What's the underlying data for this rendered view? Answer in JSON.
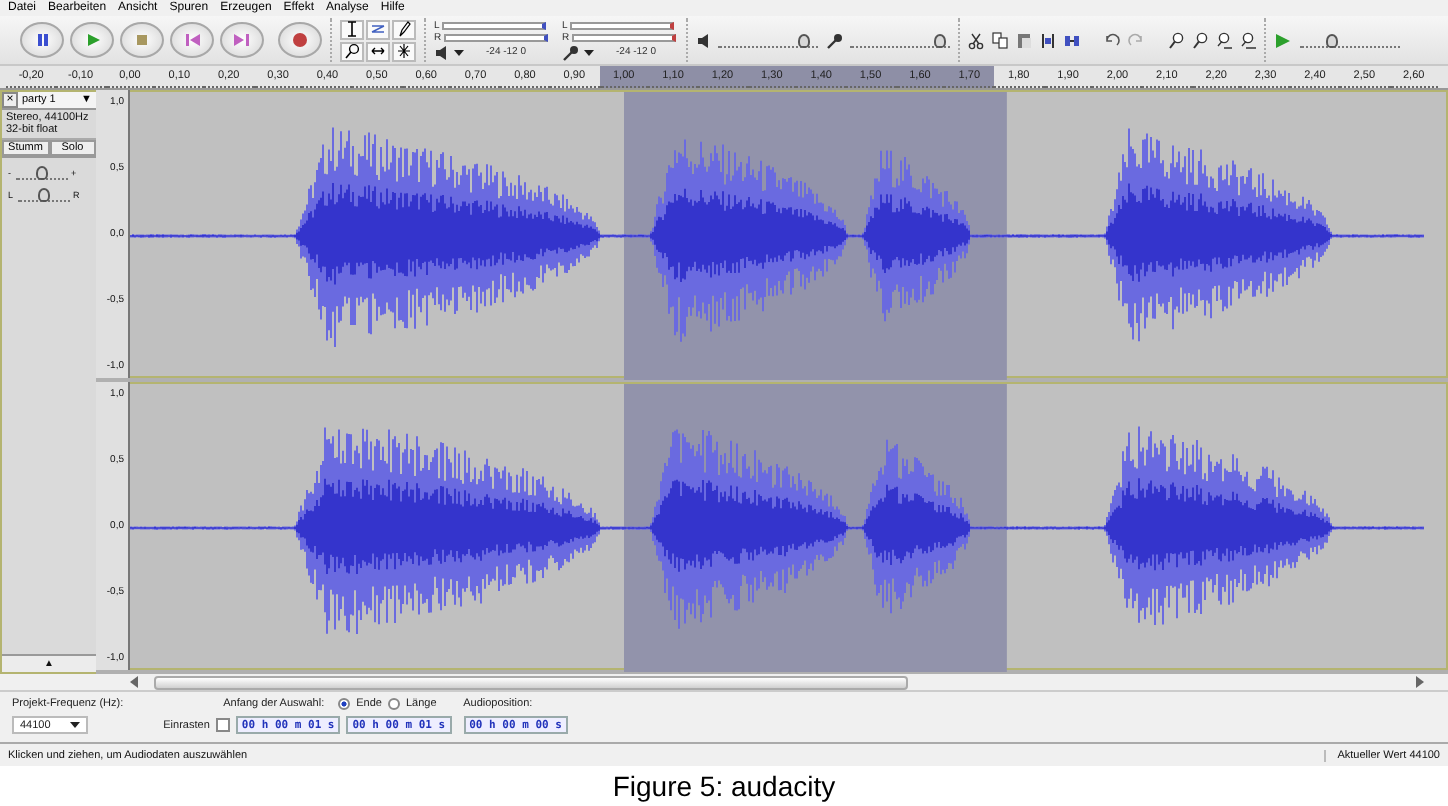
{
  "menu": [
    "Datei",
    "Bearbeiten",
    "Ansicht",
    "Spuren",
    "Erzeugen",
    "Effekt",
    "Analyse",
    "Hilfe"
  ],
  "toolbar": {
    "meters": [
      {
        "kind": "playback",
        "channels": [
          "L",
          "R"
        ],
        "scale": "-24 -12 0"
      },
      {
        "kind": "record",
        "channels": [
          "L",
          "R"
        ],
        "scale": "-24 -12 0"
      }
    ],
    "volume_sliders": [
      {
        "kind": "playback",
        "level": 0.92
      },
      {
        "kind": "record",
        "level": 0.95
      }
    ],
    "play_at_speed": {
      "level": 0.3
    }
  },
  "ruler": {
    "ticks": [
      {
        "label": "-0,20",
        "selected": false
      },
      {
        "label": "-0,10",
        "selected": false
      },
      {
        "label": "0,00",
        "selected": false
      },
      {
        "label": "0,10",
        "selected": false
      },
      {
        "label": "0,20",
        "selected": false
      },
      {
        "label": "0,30",
        "selected": false
      },
      {
        "label": "0,40",
        "selected": false
      },
      {
        "label": "0,50",
        "selected": false
      },
      {
        "label": "0,60",
        "selected": false
      },
      {
        "label": "0,70",
        "selected": false
      },
      {
        "label": "0,80",
        "selected": false
      },
      {
        "label": "0,90",
        "selected": false
      },
      {
        "label": "1,00",
        "selected": true
      },
      {
        "label": "1,10",
        "selected": true
      },
      {
        "label": "1,20",
        "selected": true
      },
      {
        "label": "1,30",
        "selected": true
      },
      {
        "label": "1,40",
        "selected": true
      },
      {
        "label": "1,50",
        "selected": true
      },
      {
        "label": "1,60",
        "selected": true
      },
      {
        "label": "1,70",
        "selected": true
      },
      {
        "label": "1,80",
        "selected": false
      },
      {
        "label": "1,90",
        "selected": false
      },
      {
        "label": "2,00",
        "selected": false
      },
      {
        "label": "2,10",
        "selected": false
      },
      {
        "label": "2,20",
        "selected": false
      },
      {
        "label": "2,30",
        "selected": false
      },
      {
        "label": "2,40",
        "selected": false
      },
      {
        "label": "2,50",
        "selected": false
      },
      {
        "label": "2,60",
        "selected": false
      }
    ]
  },
  "track": {
    "close": "×",
    "name": "party 1",
    "menu_arrow": "▼",
    "info": [
      "Stereo, 44100Hz",
      "32-bit float"
    ],
    "buttons": [
      "Stumm",
      "Solo"
    ],
    "gain": {
      "min": "-",
      "max": "+",
      "level": 0.5
    },
    "pan": {
      "min": "L",
      "max": "R",
      "level": 0.5
    },
    "collapse": "▲",
    "channels": [
      {
        "scale": [
          "1,0",
          "0,5",
          "0,0",
          "-0,5",
          "-1,0"
        ]
      },
      {
        "scale": [
          "1,0",
          "0,5",
          "0,0",
          "-0,5",
          "-1,0"
        ]
      }
    ]
  },
  "selection_bar": {
    "rate_label": "Projekt-Frequenz (Hz):",
    "rate": "44100",
    "snap_label": "Einrasten",
    "snap_checked": false,
    "start_label": "Anfang der Auswahl:",
    "end_modes": [
      {
        "label": "Ende",
        "selected": true
      },
      {
        "label": "Länge",
        "selected": false
      }
    ],
    "start_time": "00 h 00 m 01 s",
    "end_time": "00 h 00 m 01 s",
    "position_label": "Audioposition:",
    "position_time": "00 h 00 m 00 s"
  },
  "status_bar": {
    "message": "Klicken und ziehen, um Audiodaten auszuwählen",
    "value": "Aktueller Wert 44100"
  },
  "caption": "Figure 5: audacity"
}
